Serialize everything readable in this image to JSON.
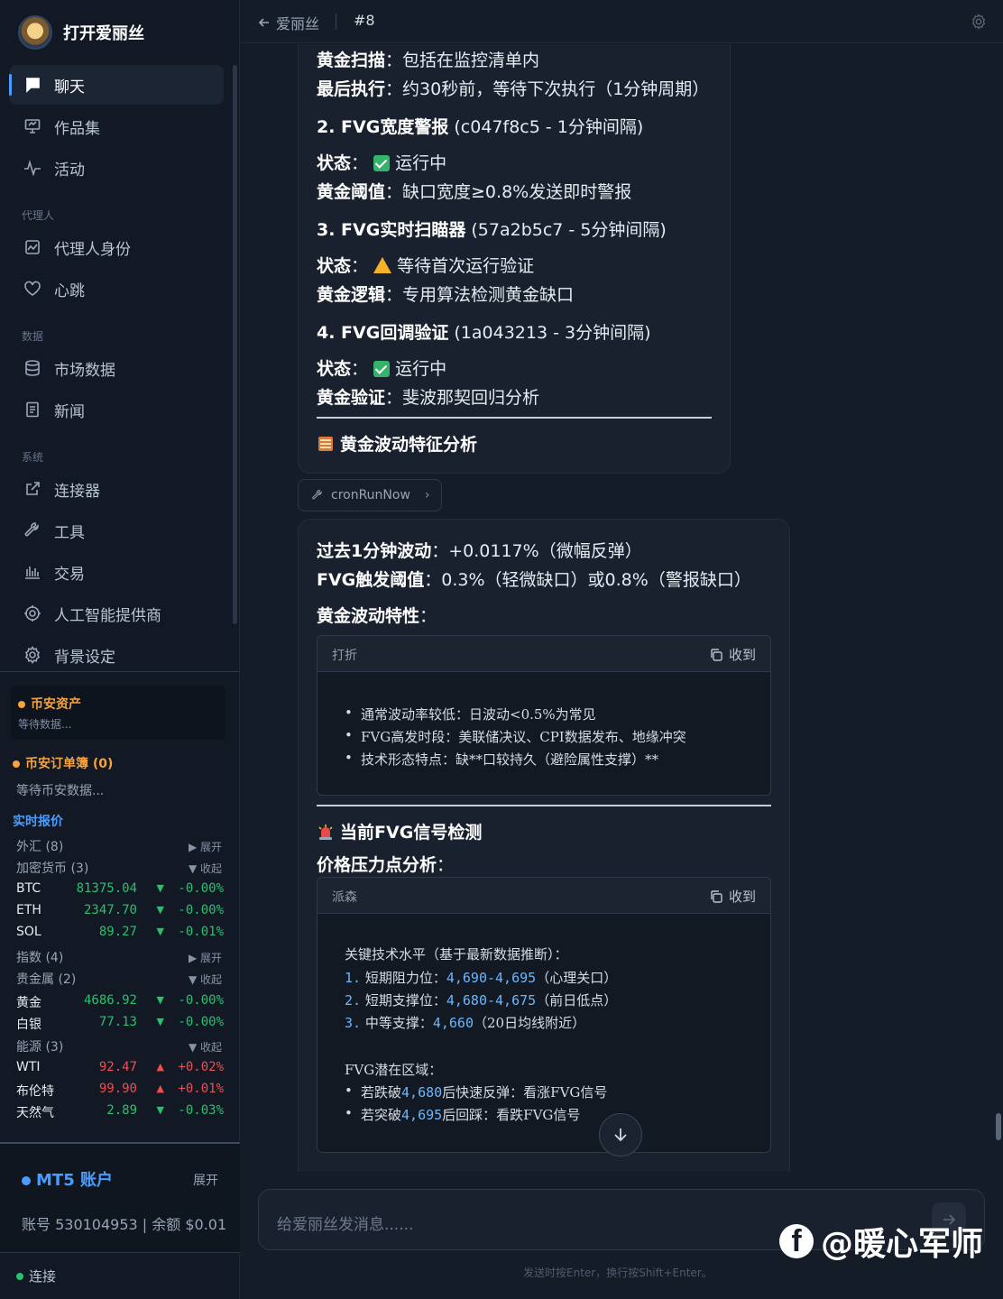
{
  "app": {
    "brand": "打开爱丽丝"
  },
  "sidebar": {
    "nav_main": [
      {
        "label": "聊天",
        "icon": "chat-icon",
        "active": true
      },
      {
        "label": "作品集",
        "icon": "monitor-icon"
      },
      {
        "label": "活动",
        "icon": "activity-icon"
      }
    ],
    "section_agent": "代理人",
    "nav_agent": [
      {
        "label": "代理人身份",
        "icon": "identity-icon"
      },
      {
        "label": "心跳",
        "icon": "heart-icon"
      }
    ],
    "section_data": "数据",
    "nav_data": [
      {
        "label": "市场数据",
        "icon": "database-icon"
      },
      {
        "label": "新闻",
        "icon": "news-icon"
      }
    ],
    "section_system": "系统",
    "nav_system": [
      {
        "label": "连接器",
        "icon": "external-link-icon"
      },
      {
        "label": "工具",
        "icon": "wrench-icon"
      },
      {
        "label": "交易",
        "icon": "chart-bars-icon"
      },
      {
        "label": "人工智能提供商",
        "icon": "ai-provider-icon"
      },
      {
        "label": "背景设定",
        "icon": "gear-icon"
      }
    ]
  },
  "binance_assets": {
    "title": "币安资产",
    "status": "等待数据..."
  },
  "binance_orders": {
    "title": "币安订单簿 (0)",
    "status": "等待币安数据..."
  },
  "quotes": {
    "title": "实时报价",
    "forex": {
      "label": "外汇 (8)",
      "toggle": "▶ 展开"
    },
    "crypto": {
      "label": "加密货币 (3)",
      "toggle": "▼ 收起"
    },
    "crypto_rows": [
      {
        "sym": "BTC",
        "price": "81375.04",
        "chg": "-0.00%",
        "dir": "down"
      },
      {
        "sym": "ETH",
        "price": "2347.70",
        "chg": "-0.00%",
        "dir": "down"
      },
      {
        "sym": "SOL",
        "price": "89.27",
        "chg": "-0.01%",
        "dir": "down"
      }
    ],
    "index": {
      "label": "指数 (4)",
      "toggle": "▶ 展开"
    },
    "metals": {
      "label": "贵金属 (2)",
      "toggle": "▼ 收起"
    },
    "metal_rows": [
      {
        "sym": "黄金",
        "price": "4686.92",
        "chg": "-0.00%",
        "dir": "down"
      },
      {
        "sym": "白银",
        "price": "77.13",
        "chg": "-0.00%",
        "dir": "down"
      }
    ],
    "energy": {
      "label": "能源 (3)",
      "toggle": "▼ 收起"
    },
    "energy_rows": [
      {
        "sym": "WTI",
        "price": "92.47",
        "chg": "+0.02%",
        "dir": "up"
      },
      {
        "sym": "布伦特",
        "price": "99.90",
        "chg": "+0.01%",
        "dir": "up"
      },
      {
        "sym": "天然气",
        "price": "2.89",
        "chg": "-0.03%",
        "dir": "down"
      }
    ]
  },
  "mt5": {
    "title": "MT5 账户",
    "expand": "展开",
    "account": "账号 530104953 | 余额 $0.01"
  },
  "connection": {
    "label": "连接"
  },
  "header": {
    "back_label": "爱丽丝",
    "chat_id": "#8"
  },
  "message1": {
    "l1_key": "黄金扫描",
    "l1_val": "：包括在监控清单内",
    "l2_key": "最后执行",
    "l2_val": "：约30秒前，等待下次执行（1分钟周期）",
    "l3_key": "2. FVG宽度警报",
    "l3_val": " (c047f8c5 - 1分钟间隔)",
    "l4_key": "状态",
    "l4_val": "运行中",
    "l5_key": "黄金阈值",
    "l5_val": "：缺口宽度≥0.8%发送即时警报",
    "l6_key": "3. FVG实时扫瞄器",
    "l6_val": " (57a2b5c7 - 5分钟间隔)",
    "l7_key": "状态",
    "l7_val": "等待首次运行验证",
    "l8_key": "黄金逻辑",
    "l8_val": "：专用算法检测黄金缺口",
    "l9_key": "4. FVG回调验证",
    "l9_val": " (1a043213 - 3分钟间隔)",
    "l10_key": "状态",
    "l10_val": "运行中",
    "l11_key": "黄金验证",
    "l11_val": "：斐波那契回归分析",
    "l12_heading": "黄金波动特征分析"
  },
  "tool_chip": {
    "label": "cronRunNow"
  },
  "message2": {
    "l1_key": "过去1分钟波动",
    "l1_val": "：+0.0117%（微幅反弹）",
    "l2_key": "FVG触发阈值",
    "l2_val": "：0.3%（轻微缺口）或0.8%（警报缺口）",
    "l3_key": "黄金波动特性",
    "l3_val": "：",
    "code1": {
      "lang": "打折",
      "collapse": "收到",
      "lines": [
        "通常波动率较低：日波动<0.5%为常见",
        "FVG高发时段：美联储决议、CPI数据发布、地缘冲突",
        "技术形态特点：缺**口较持久（避险属性支撑）**"
      ]
    },
    "heading2": "当前FVG信号检测",
    "l4_key": "价格压力点分析",
    "l4_val": "：",
    "code2": {
      "lang": "派森",
      "collapse": "收到",
      "title": "关键技术水平（基于最新数据推断）：",
      "levels": [
        {
          "n": "1.",
          "pre": " 短期阻力位：",
          "num": "4,690-4,695",
          "post": "（心理关口）"
        },
        {
          "n": "2.",
          "pre": " 短期支撑位：",
          "num": "4,680-4,675",
          "post": "（前日低点）"
        },
        {
          "n": "3.",
          "pre": " 中等支撑：",
          "num": "4,660",
          "post": "（20日均线附近）"
        }
      ],
      "fvg_title": "FVG潜在区域：",
      "fvg_lines": [
        {
          "pre": "若跌破",
          "num": "4,680",
          "post": "后快速反弹：看涨FVG信号"
        },
        {
          "pre": "若突破",
          "num": "4,695",
          "post": "后回踩：看跌FVG信号"
        }
      ]
    }
  },
  "composer": {
    "placeholder": "给爱丽丝发消息......"
  },
  "hint": "发送时按Enter，换行按Shift+Enter。",
  "watermark": {
    "text": "@暖心军师"
  },
  "colors": {
    "accent": "#4a9cff",
    "up": "#ef4f4f",
    "down": "#27c26b",
    "warning": "#f7a23c"
  }
}
